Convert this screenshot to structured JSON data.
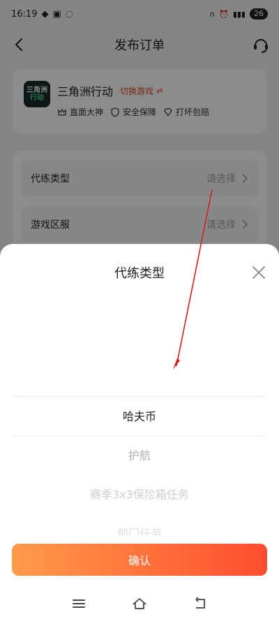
{
  "status": {
    "time": "16:19",
    "battery": "26"
  },
  "header": {
    "title": "发布订单"
  },
  "game": {
    "logo_line1": "三角洲",
    "logo_line2": "行动",
    "name": "三角洲行动",
    "switch_label": "切换游戏",
    "badges": [
      "直面大神",
      "安全保障",
      "打坏包赔"
    ]
  },
  "form": {
    "rows": [
      {
        "label": "代练类型",
        "value": "请选择"
      },
      {
        "label": "游戏区服",
        "value": "请选择"
      }
    ]
  },
  "sheet": {
    "title": "代练类型",
    "options": [
      "哈夫币",
      "护航",
      "赛季3x3保险箱任务",
      "部门任务"
    ],
    "confirm_label": "确认"
  },
  "colors": {
    "accent": "#ff4d2e",
    "accent_start": "#ff9b4a",
    "annotation": "#d32020"
  }
}
